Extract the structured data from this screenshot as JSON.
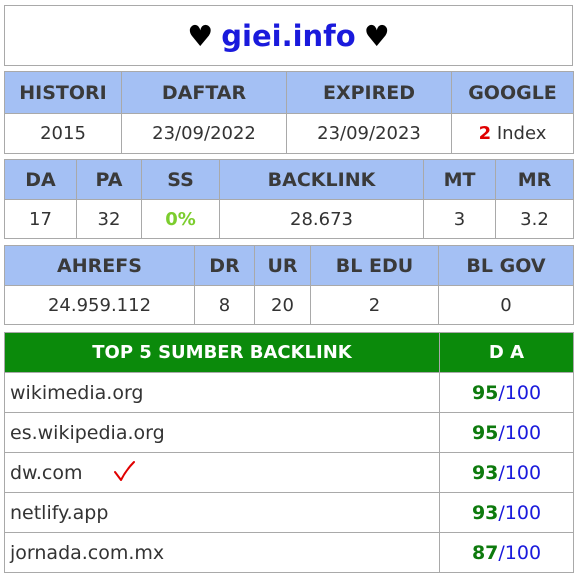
{
  "title": {
    "heart_left": "♥",
    "domain": "giei.info",
    "heart_right": "♥"
  },
  "table1": {
    "headers": [
      "HISTORI",
      "DAFTAR",
      "EXPIRED",
      "GOOGLE"
    ],
    "values": {
      "histori": "2015",
      "daftar": "23/09/2022",
      "expired": "23/09/2023",
      "google_count": "2",
      "google_label": "Index"
    }
  },
  "table2": {
    "headers": [
      "DA",
      "PA",
      "SS",
      "BACKLINK",
      "MT",
      "MR"
    ],
    "values": [
      "17",
      "32",
      "0%",
      "28.673",
      "3",
      "3.2"
    ]
  },
  "table3": {
    "headers": [
      "AHREFS",
      "DR",
      "UR",
      "BL EDU",
      "BL GOV"
    ],
    "values": [
      "24.959.112",
      "8",
      "20",
      "2",
      "0"
    ]
  },
  "sources": {
    "header_left": "TOP 5 SUMBER BACKLINK",
    "header_right": "D A",
    "rows": [
      {
        "name": "wikimedia.org",
        "da": "95",
        "max": "/100"
      },
      {
        "name": "es.wikipedia.org",
        "da": "95",
        "max": "/100"
      },
      {
        "name": "dw.com",
        "da": "93",
        "max": "/100"
      },
      {
        "name": "netlify.app",
        "da": "93",
        "max": "/100"
      },
      {
        "name": "jornada.com.mx",
        "da": "87",
        "max": "/100"
      }
    ]
  },
  "colors": {
    "header_blue": "#a4c0f4",
    "header_green": "#0b8a0b",
    "domain_blue": "#1a1adc",
    "check_red": "#e00000"
  },
  "icons": {
    "hearts": "heart-icon",
    "mark": "checkmark-icon"
  }
}
